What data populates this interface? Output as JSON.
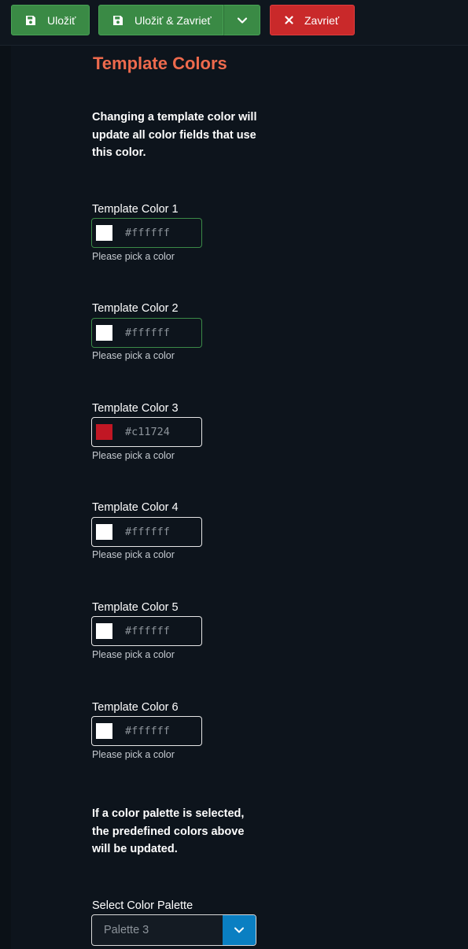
{
  "toolbar": {
    "save_label": "Uložiť",
    "save_close_label": "Uložiť & Zavrieť",
    "close_label": "Zavrieť"
  },
  "section": {
    "title": "Template Colors",
    "intro": "Changing a template color will update all color fields that use this color.",
    "palette_note": "If a color palette is selected, the predefined colors above will be updated."
  },
  "colors": [
    {
      "label": "Template Color 1",
      "value": "#ffffff",
      "swatch": "#ffffff",
      "help": "Please pick a color"
    },
    {
      "label": "Template Color 2",
      "value": "#ffffff",
      "swatch": "#ffffff",
      "help": "Please pick a color"
    },
    {
      "label": "Template Color 3",
      "value": "#c11724",
      "swatch": "#c11724",
      "help": "Please pick a color"
    },
    {
      "label": "Template Color 4",
      "value": "#ffffff",
      "swatch": "#ffffff",
      "help": "Please pick a color"
    },
    {
      "label": "Template Color 5",
      "value": "#ffffff",
      "swatch": "#ffffff",
      "help": "Please pick a color"
    },
    {
      "label": "Template Color 6",
      "value": "#ffffff",
      "swatch": "#ffffff",
      "help": "Please pick a color"
    }
  ],
  "palette": {
    "label": "Select Color Palette",
    "selected": "Palette 3"
  },
  "theme": {
    "accent": "#ee6a4d",
    "success": "#3a8a45",
    "danger": "#c9292a",
    "select_caret": "#0a7fc2"
  }
}
